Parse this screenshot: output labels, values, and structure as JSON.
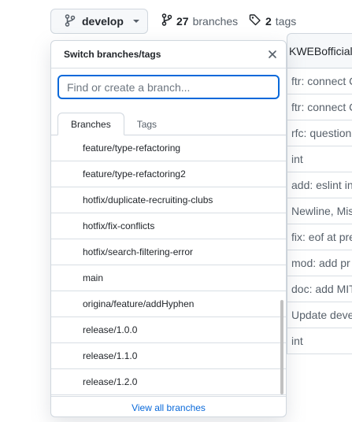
{
  "header": {
    "branch_button_label": "develop",
    "branches_count": "27",
    "branches_label": "branches",
    "tags_count": "2",
    "tags_label": "tags"
  },
  "background_list": {
    "header": "KWEBofficial/",
    "rows": [
      "ftr: connect C",
      "ftr: connect C",
      "rfc: question",
      "int",
      "add: eslint in",
      "Newline, Mis",
      "fix: eof at pre",
      "mod: add pr",
      "doc: add MIT",
      "Update deve",
      "int"
    ]
  },
  "dropdown": {
    "title": "Switch branches/tags",
    "filter_placeholder": "Find or create a branch...",
    "tabs": [
      {
        "label": "Branches",
        "active": true
      },
      {
        "label": "Tags",
        "active": false
      }
    ],
    "items": [
      "feature/type-refactoring",
      "feature/type-refactoring2",
      "hotfix/duplicate-recruiting-clubs",
      "hotfix/fix-conflicts",
      "hotfix/search-filtering-error",
      "main",
      "origina/feature/addHyphen",
      "release/1.0.0",
      "release/1.1.0",
      "release/1.2.0"
    ],
    "footer_link": "View all branches"
  },
  "colors": {
    "accent": "#0969da",
    "border": "#d0d7de",
    "muted_text": "#57606a"
  },
  "icons": {
    "branch": "git-branch-icon",
    "tag": "tag-icon",
    "close": "close-icon",
    "caret": "chevron-down-icon"
  }
}
